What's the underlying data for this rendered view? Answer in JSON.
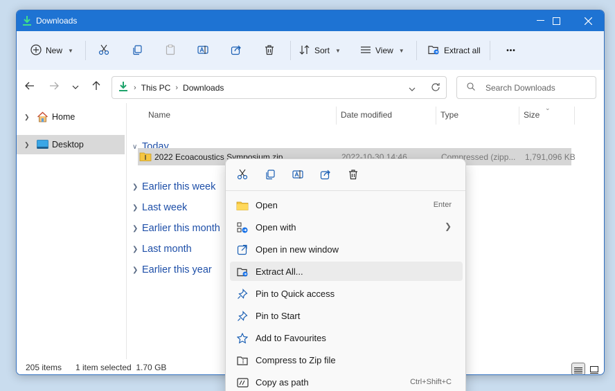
{
  "window": {
    "title": "Downloads"
  },
  "toolbar": {
    "new_label": "New",
    "sort_label": "Sort",
    "view_label": "View",
    "extract_all_label": "Extract all",
    "more_label": "•••"
  },
  "address": {
    "crumbs": [
      "This PC",
      "Downloads"
    ],
    "search_placeholder": "Search Downloads"
  },
  "sidebar": {
    "items": [
      {
        "label": "Home"
      },
      {
        "label": "Desktop"
      }
    ]
  },
  "columns": {
    "name": "Name",
    "date": "Date modified",
    "type": "Type",
    "size": "Size"
  },
  "groups": [
    "Today",
    "Earlier this week",
    "Last week",
    "Earlier this month",
    "Last month",
    "Earlier this year"
  ],
  "file": {
    "name": "2022 Ecoacoustics Symposium.zip",
    "date": "2022-10-30 14:46",
    "type": "Compressed (zipp...",
    "size": "1,791,096 KB"
  },
  "status": {
    "count": "205 items",
    "selected": "1 item selected  1.70 GB"
  },
  "context_menu": {
    "items": [
      {
        "label": "Open",
        "shortcut": "Enter"
      },
      {
        "label": "Open with",
        "shortcut": ""
      },
      {
        "label": "Open in new window",
        "shortcut": ""
      },
      {
        "label": "Extract All...",
        "shortcut": ""
      },
      {
        "label": "Pin to Quick access",
        "shortcut": ""
      },
      {
        "label": "Pin to Start",
        "shortcut": ""
      },
      {
        "label": "Add to Favourites",
        "shortcut": ""
      },
      {
        "label": "Compress to Zip file",
        "shortcut": ""
      },
      {
        "label": "Copy as path",
        "shortcut": "Ctrl+Shift+C"
      }
    ]
  },
  "colors": {
    "titlebar": "#1e73d3",
    "toolbar_bg": "#eaf1fb",
    "group_text": "#1e4fa8",
    "selection": "#d6d6d6"
  }
}
